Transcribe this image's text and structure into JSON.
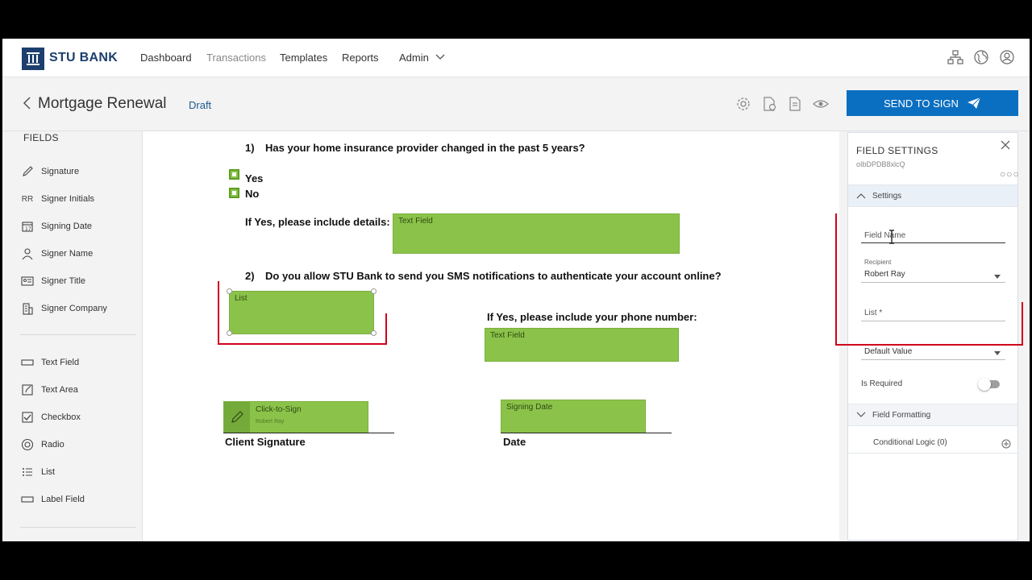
{
  "brand": {
    "name": "STU BANK"
  },
  "nav": {
    "items": [
      {
        "label": "Dashboard"
      },
      {
        "label": "Transactions"
      },
      {
        "label": "Templates"
      },
      {
        "label": "Reports"
      },
      {
        "label": "Admin"
      }
    ]
  },
  "header": {
    "title": "Mortgage Renewal",
    "status": "Draft",
    "send_label": "SEND TO SIGN"
  },
  "fields_panel": {
    "title": "FIELDS",
    "items": [
      {
        "label": "Signature",
        "icon": "pen-icon"
      },
      {
        "label": "Signer Initials",
        "icon": "initials-icon",
        "icon_text": "RR"
      },
      {
        "label": "Signing Date",
        "icon": "calendar-icon"
      },
      {
        "label": "Signer Name",
        "icon": "person-icon"
      },
      {
        "label": "Signer Title",
        "icon": "id-card-icon"
      },
      {
        "label": "Signer Company",
        "icon": "building-icon"
      },
      {
        "label": "Text Field",
        "icon": "text-field-icon"
      },
      {
        "label": "Text Area",
        "icon": "text-area-icon"
      },
      {
        "label": "Checkbox",
        "icon": "checkbox-icon"
      },
      {
        "label": "Radio",
        "icon": "radio-icon"
      },
      {
        "label": "List",
        "icon": "list-icon"
      },
      {
        "label": "Label Field",
        "icon": "label-field-icon"
      }
    ]
  },
  "document": {
    "q1": {
      "number": "1)",
      "text": "Has your home insurance provider changed in the past 5 years?"
    },
    "options": [
      "Yes",
      "No"
    ],
    "details_label": "If Yes, please include details:",
    "details_field": "Text Field",
    "q2": {
      "number": "2)",
      "text": "Do you allow STU Bank to send you SMS notifications to authenticate your account online?"
    },
    "list_field": "List",
    "phone_label": "If Yes, please include your phone number:",
    "phone_field": "Text Field",
    "signature_field": {
      "label": "Click-to-Sign",
      "signer": "Robert Ray"
    },
    "date_field": "Signing Date",
    "client_signature": "Client Signature",
    "date_label": "Date"
  },
  "settings": {
    "title": "FIELD SETTINGS",
    "field_id": "oIbDPDB8xlcQ",
    "section_settings": "Settings",
    "field_name_placeholder": "Field Name",
    "recipient_label": "Recipient",
    "recipient_value": "Robert Ray",
    "list_placeholder": "List *",
    "default_value_placeholder": "Default Value",
    "is_required_label": "Is Required",
    "is_required": false,
    "section_formatting": "Field Formatting",
    "section_conditional": "Conditional Logic (0)"
  },
  "colors": {
    "brand_navy": "#1c3f6e",
    "primary_blue": "#0b6fc1",
    "field_green": "#8bc34a",
    "highlight_red": "#d0021b"
  }
}
